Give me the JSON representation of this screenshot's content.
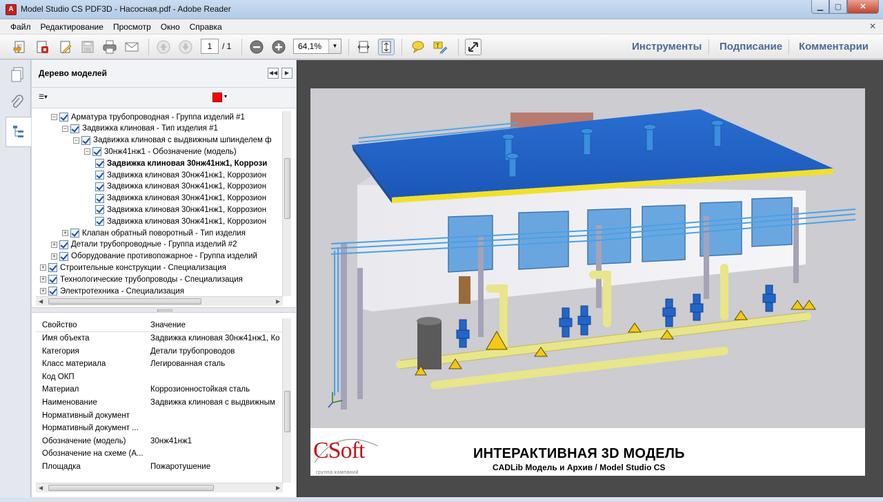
{
  "window": {
    "title": "Model Studio CS PDF3D - Насосная.pdf - Adobe Reader",
    "app_icon_label": "A"
  },
  "menu": {
    "items": [
      "Файл",
      "Редактирование",
      "Просмотр",
      "Окно",
      "Справка"
    ]
  },
  "toolbar": {
    "page_current": "1",
    "page_total": "/ 1",
    "zoom": "64,1%",
    "links": [
      "Инструменты",
      "Подписание",
      "Комментарии"
    ]
  },
  "model_tree": {
    "title": "Дерево моделей",
    "highlight_color": "#ff0000",
    "items": [
      {
        "label": "Арматура трубопроводная - Группа изделий #1",
        "expander": "−",
        "bold": false
      },
      {
        "label": "Задвижка клиновая - Тип изделия #1",
        "expander": "−",
        "bold": false
      },
      {
        "label": "Задвижка клиновая с выдвижным шпинделем ф",
        "expander": "−",
        "bold": false
      },
      {
        "label": "30нж41нж1 - Обозначение (модель)",
        "expander": "−",
        "bold": false
      },
      {
        "label": "Задвижка клиновая 30нж41нж1, Коррози",
        "expander": "",
        "bold": true
      },
      {
        "label": "Задвижка клиновая 30нж41нж1, Коррозион",
        "expander": "",
        "bold": false
      },
      {
        "label": "Задвижка клиновая 30нж41нж1, Коррозион",
        "expander": "",
        "bold": false
      },
      {
        "label": "Задвижка клиновая 30нж41нж1, Коррозион",
        "expander": "",
        "bold": false
      },
      {
        "label": "Задвижка клиновая 30нж41нж1, Коррозион",
        "expander": "",
        "bold": false
      },
      {
        "label": "Задвижка клиновая 30нж41нж1, Коррозион",
        "expander": "",
        "bold": false
      },
      {
        "label": "Клапан обратный поворотный - Тип изделия",
        "expander": "+",
        "bold": false
      },
      {
        "label": "Детали трубопроводные - Группа изделий #2",
        "expander": "+",
        "bold": false
      },
      {
        "label": "Оборудование противопожарное - Группа изделий",
        "expander": "+",
        "bold": false
      },
      {
        "label": "Строительные конструкции - Специализация",
        "expander": "+",
        "bold": false
      },
      {
        "label": "Технологические трубопроводы - Специализация",
        "expander": "+",
        "bold": false
      },
      {
        "label": "Электротехника - Специализация",
        "expander": "+",
        "bold": false
      }
    ]
  },
  "properties": {
    "header_property": "Свойство",
    "header_value": "Значение",
    "rows": [
      {
        "k": "Имя объекта",
        "v": "Задвижка клиновая 30нж41нж1, Ко"
      },
      {
        "k": "Категория",
        "v": "Детали трубопроводов"
      },
      {
        "k": "Класс материала",
        "v": "Легированная сталь"
      },
      {
        "k": "Код ОКП",
        "v": ""
      },
      {
        "k": "Материал",
        "v": "Коррозионностойкая сталь"
      },
      {
        "k": "Наименование",
        "v": "Задвижка клиновая с выдвижным"
      },
      {
        "k": "Нормативный документ",
        "v": ""
      },
      {
        "k": "Нормативный документ ...",
        "v": ""
      },
      {
        "k": "Обозначение (модель)",
        "v": "30нж41нж1"
      },
      {
        "k": "Обозначение на схеме (А...",
        "v": ""
      },
      {
        "k": "Площадка",
        "v": "Пожаротушение"
      }
    ]
  },
  "document": {
    "title": "ИНТЕРАКТИВНАЯ 3D МОДЕЛЬ",
    "subtitle": "CADLib Модель и Архив / Model Studio CS",
    "logo_text": "CSoft",
    "logo_tagline": "группа компаний"
  }
}
